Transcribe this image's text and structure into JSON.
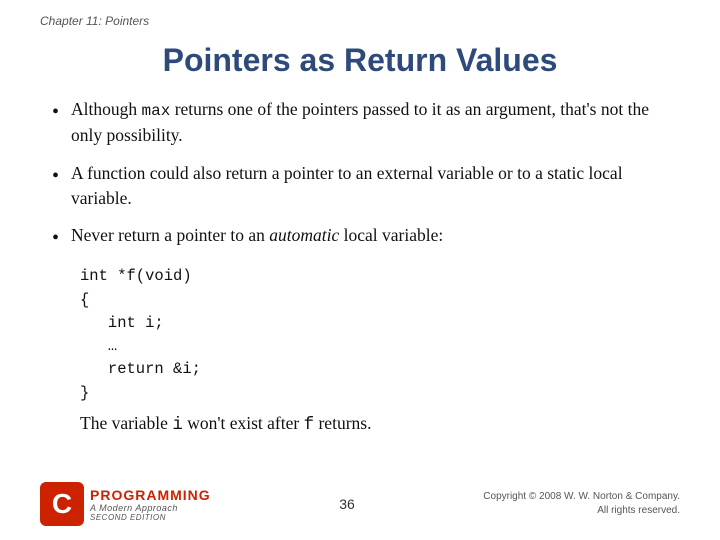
{
  "chapter_label": "Chapter 11: Pointers",
  "title": "Pointers as Return Values",
  "bullets": [
    {
      "id": "bullet1",
      "text_parts": [
        {
          "type": "text",
          "content": "Although "
        },
        {
          "type": "code",
          "content": "max"
        },
        {
          "type": "text",
          "content": " returns one of the pointers passed to it as an argument, that's not the only possibility."
        }
      ],
      "plain": "Although max returns one of the pointers passed to it as an argument, that's not the only possibility."
    },
    {
      "id": "bullet2",
      "text_parts": [
        {
          "type": "text",
          "content": "A function could also return a pointer to an external variable or to a static local variable."
        }
      ],
      "plain": "A function could also return a pointer to an external variable or to a static local variable."
    },
    {
      "id": "bullet3",
      "text_parts": [
        {
          "type": "text",
          "content": "Never return a pointer to an "
        },
        {
          "type": "italic",
          "content": "automatic"
        },
        {
          "type": "text",
          "content": " local variable:"
        }
      ],
      "plain": "Never return a pointer to an automatic local variable:"
    }
  ],
  "code_block": {
    "lines": [
      "int *f(void)",
      "{",
      "   int i;",
      "   …",
      "   return &i;",
      "}"
    ]
  },
  "closing_line": {
    "before": "The variable ",
    "var_i": "i",
    "middle": " won't exist after ",
    "var_f": "f",
    "after": " returns."
  },
  "footer": {
    "logo_c": "C",
    "logo_programming": "PROGRAMMING",
    "logo_subtitle": "A Modern Approach",
    "logo_edition": "SECOND EDITION",
    "page_number": "36",
    "copyright_line1": "Copyright © 2008 W. W. Norton & Company.",
    "copyright_line2": "All rights reserved."
  }
}
